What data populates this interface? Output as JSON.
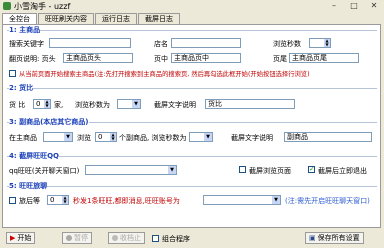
{
  "window": {
    "title": "小雪淘手 - uzzf",
    "min": "–",
    "max": "□",
    "close": "✕"
  },
  "tabs": [
    "全控台",
    "旺旺刷关内容",
    "运行日志",
    "截屏日志"
  ],
  "g1": {
    "title": "1: 主商品",
    "search_label": "搜索关键字",
    "shop_label": "店名",
    "browse_label": "浏览秒数",
    "page_label": "翻页说明: 页头",
    "page_head_value": "主商品页头",
    "page_mid_label": "页中",
    "page_mid_value": "主商品页中",
    "page_tail_label": "页尾",
    "page_tail_value": "主商品页尾",
    "notice": "从当前页面开始搜索主商品(注:先打开搜索到主商品的搜索页, 然后再勾选此框开始(开始按钮选择行浏览)"
  },
  "g2": {
    "title": "2: 货比",
    "huobi_label": "货 比",
    "count_value": "0",
    "unit_label": "家,",
    "browse_label": "浏览秒数为",
    "screenshot_label": "截屏文字说明",
    "screenshot_value": "货比"
  },
  "g3": {
    "title": "3: 副商品(本店其它商品)",
    "on_main_label": "在主商品",
    "times_label": "浏览",
    "count_value": "0",
    "items_label": "个副商品, 浏览秒数为",
    "screenshot_label": "截屏文字说明",
    "screenshot_value": "副商品"
  },
  "g4": {
    "title": "4: 截屏旺旺QQ",
    "qq_label": "qq旺旺(关开聊天窗口)",
    "cb1_label": "截屏浏览页面",
    "cb2_label": "截屏后立即退出"
  },
  "g5": {
    "title": "5: 旺旺旅聊",
    "cb_label": "旅后等",
    "spin_value": "0",
    "desc": "秒发1条旺旺,都即消息,旺旺账号为",
    "hint": "(注:需先开启旺旺聊天窗口)"
  },
  "bottom": {
    "start": "开始",
    "pause": "暂停",
    "stop": "收档止",
    "log_cb": "组合程序",
    "save": "保存所有设置"
  }
}
